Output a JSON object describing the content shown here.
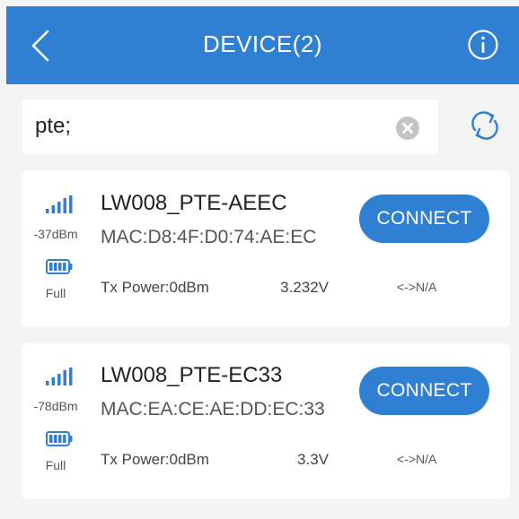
{
  "header": {
    "title": "DEVICE(2)",
    "color": "#2f7fd3"
  },
  "search": {
    "value": "pte;"
  },
  "devices": [
    {
      "name": "LW008_PTE-AEEC",
      "rssi": "-37dBm",
      "mac": "MAC:D8:4F:D0:74:AE:EC",
      "battery": "Full",
      "tx_power": "Tx Power:0dBm",
      "voltage": "3.232V",
      "status": "<->N/A",
      "button": "CONNECT"
    },
    {
      "name": "LW008_PTE-EC33",
      "rssi": "-78dBm",
      "mac": "MAC:EA:CE:AE:DD:EC:33",
      "battery": "Full",
      "tx_power": "Tx Power:0dBm",
      "voltage": "3.3V",
      "status": "<->N/A",
      "button": "CONNECT"
    }
  ],
  "icons": {
    "back": "back-arrow-icon",
    "info": "info-icon",
    "clear": "clear-search-icon",
    "refresh": "refresh-icon",
    "signal": "signal-strength-icon",
    "battery": "battery-icon"
  }
}
